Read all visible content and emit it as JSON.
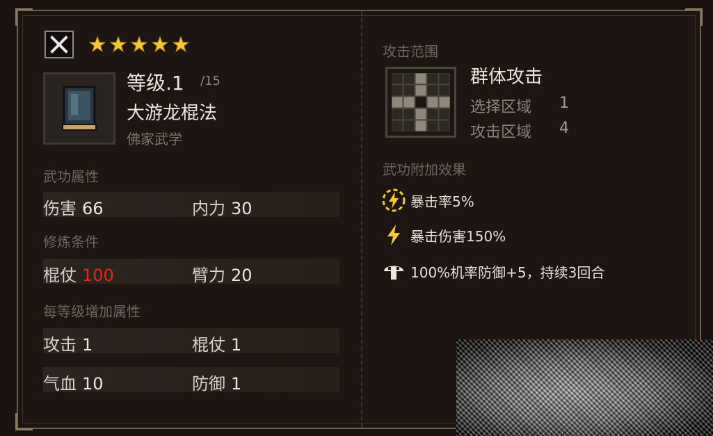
{
  "header": {
    "close_icon": "close-icon",
    "stars": 5,
    "star_color": "#f3c93a"
  },
  "skill": {
    "icon": "book-icon",
    "level": "等级.1",
    "level_max": "/15",
    "name": "大游龙棍法",
    "school": "佛家武学"
  },
  "attributes": {
    "label": "武功属性",
    "items": [
      {
        "label": "伤害",
        "value": "66"
      },
      {
        "label": "内力",
        "value": "30"
      }
    ]
  },
  "requirements": {
    "label": "修炼条件",
    "items": [
      {
        "label": "棍仗",
        "value": "100",
        "unmet": true
      },
      {
        "label": "臂力",
        "value": "20"
      }
    ]
  },
  "per_level": {
    "label": "每等级增加属性",
    "rows": [
      [
        {
          "label": "攻击",
          "value": "1"
        },
        {
          "label": "棍仗",
          "value": "1"
        }
      ],
      [
        {
          "label": "气血",
          "value": "10"
        },
        {
          "label": "防御",
          "value": "1"
        }
      ]
    ]
  },
  "range": {
    "label": "攻击范围",
    "title": "群体攻击",
    "select_label": "选择区域",
    "select_value": "1",
    "attack_label": "攻击区域",
    "attack_value": "4"
  },
  "effects": {
    "label": "武功附加效果",
    "items": [
      {
        "icon": "lightning-circle-icon",
        "text": "暴击率5%"
      },
      {
        "icon": "lightning-icon",
        "text": "暴击伤害150%"
      },
      {
        "icon": "shield-mushroom-icon",
        "text": "100%机率防御+5，持续3回合"
      }
    ]
  },
  "colors": {
    "unmet_requirement": "#e02a1c",
    "accent_gold": "#f3c93a"
  }
}
